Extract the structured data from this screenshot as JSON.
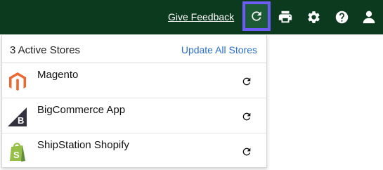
{
  "header": {
    "feedback_label": "Give Feedback",
    "icons": [
      "refresh-icon",
      "printer-icon",
      "gear-icon",
      "help-icon",
      "user-icon"
    ],
    "background_color": "#0b3a1f",
    "highlight_color": "#6d5cf5"
  },
  "stores_panel": {
    "active_count_label": "3 Active Stores",
    "update_all_label": "Update All Stores",
    "stores": [
      {
        "name": "Magento",
        "logo": "magento-logo-icon"
      },
      {
        "name": "BigCommerce App",
        "logo": "bigcommerce-logo-icon"
      },
      {
        "name": "ShipStation Shopify",
        "logo": "shopify-logo-icon"
      }
    ]
  }
}
